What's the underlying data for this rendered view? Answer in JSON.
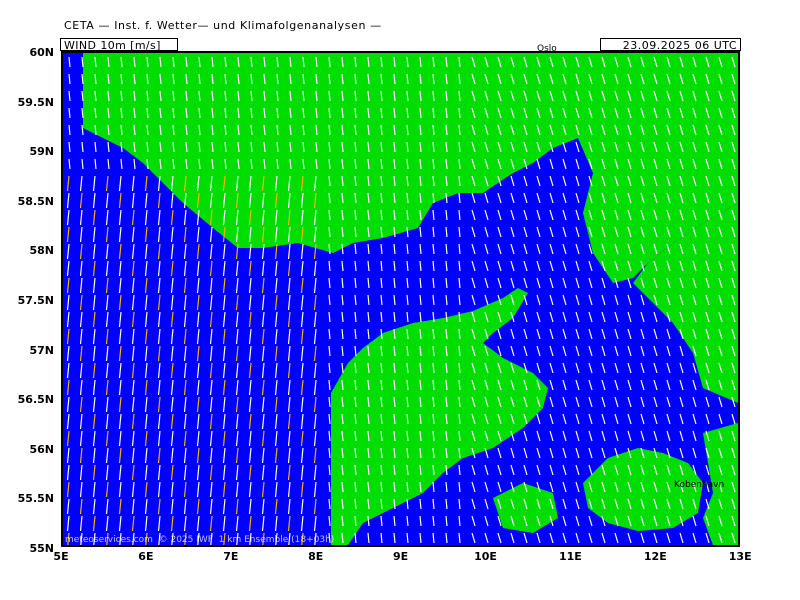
{
  "header": {
    "title": "CETA — Inst. f. Wetter— und Klimafolgenanalysen —",
    "field": "WIND 10m [m/s]",
    "valid_time": "23.09.2025 06 UTC"
  },
  "axes": {
    "latitude_labels": [
      "60N",
      "59.5N",
      "59N",
      "58.5N",
      "58N",
      "57.5N",
      "57N",
      "56.5N",
      "56N",
      "55.5N",
      "55N"
    ],
    "longitude_labels": [
      "5E",
      "6E",
      "7E",
      "8E",
      "9E",
      "10E",
      "11E",
      "12E",
      "13E"
    ]
  },
  "map": {
    "colors": {
      "sea": "#0000ff",
      "land": "#00dd00",
      "strong_wind": "#f2b800",
      "vector": "#ffffff"
    }
  },
  "places": {
    "oslo": "Oslo",
    "kobenhavn": "Kobenhavn"
  },
  "footer": {
    "credit": "meteoservices.com  © 2025 IWF  1 km Ensemble (18+03h)"
  }
}
